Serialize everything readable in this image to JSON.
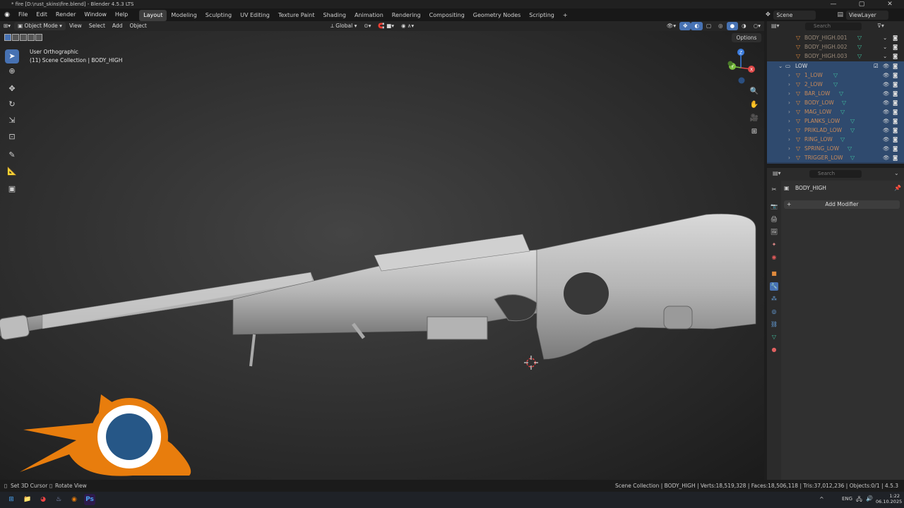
{
  "window": {
    "title": "* fire [D:\\rust_skins\\fire.blend] - Blender 4.5.3 LTS",
    "minimize": "—",
    "maximize": "▢",
    "close": "✕"
  },
  "menubar": {
    "items": [
      "File",
      "Edit",
      "Render",
      "Window",
      "Help"
    ]
  },
  "workspaces": {
    "tabs": [
      "Layout",
      "Modeling",
      "Sculpting",
      "UV Editing",
      "Texture Paint",
      "Shading",
      "Animation",
      "Rendering",
      "Compositing",
      "Geometry Nodes",
      "Scripting"
    ],
    "active": "Layout",
    "add": "+"
  },
  "scene": {
    "name": "Scene",
    "view_layer": "ViewLayer"
  },
  "viewport_header": {
    "mode": "Object Mode",
    "menus": [
      "View",
      "Select",
      "Add",
      "Object"
    ],
    "transform_orientation": "Global",
    "options_label": "Options"
  },
  "viewport": {
    "view_name": "User Orthographic",
    "collection_info": "(11) Scene Collection | BODY_HIGH",
    "gizmo": {
      "x": "X",
      "y": "Y",
      "z": "Z"
    }
  },
  "outliner": {
    "search_placeholder": "Search",
    "high_items": [
      "BODY_HIGH.001",
      "BODY_HIGH.002",
      "BODY_HIGH.003"
    ],
    "low_collection": "LOW",
    "low_items": [
      "1_LOW",
      "2_LOW",
      "BAR_LOW",
      "BODY_LOW",
      "MAG_LOW",
      "PLANKS_LOW",
      "PRIKLAD_LOW",
      "RING_LOW",
      "SPRING_LOW",
      "TRIGGER_LOW"
    ]
  },
  "properties": {
    "search_placeholder": "Search",
    "object_name": "BODY_HIGH",
    "add_modifier_label": "Add Modifier",
    "add_modifier_icon": "+"
  },
  "statusbar": {
    "hint_left": "Set 3D Cursor",
    "hint_right": "Rotate View",
    "stats": "Scene Collection | BODY_HIGH | Verts:18,519,328 | Faces:18,506,118 | Tris:37,012,236 | Objects:0/1 | 4.5.3"
  },
  "taskbar": {
    "language": "ENG",
    "time": "1:22",
    "date": "06.10.2025"
  },
  "colors": {
    "accent": "#4772b3",
    "blender_orange": "#e87d0d",
    "blender_blue": "#265787",
    "selection": "#2f4a6e"
  }
}
